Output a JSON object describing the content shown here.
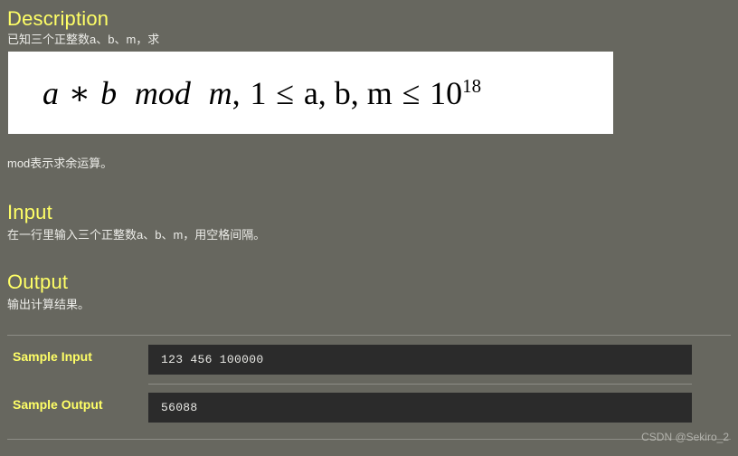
{
  "page": {
    "background_color": "#67675f",
    "heading_color": "#ffff66",
    "code_bg_color": "#2b2b2b",
    "text_color": "#ecece8"
  },
  "sections": {
    "description": {
      "heading": "Description",
      "intro_text": "已知三个正整数a、b、m，求",
      "formula": {
        "a": "a",
        "times": "∗",
        "b": "b",
        "mod": "mod",
        "m": "m",
        "comma1": ",",
        "one": "1",
        "le1": "≤",
        "vars": "a, b, m",
        "le2": "≤",
        "base": "10",
        "exponent": "18",
        "plain": "a * b mod m, 1 ≤ a, b, m ≤ 10^18"
      },
      "note_text": "mod表示求余运算。"
    },
    "input": {
      "heading": "Input",
      "text": "在一行里输入三个正整数a、b、m，用空格间隔。"
    },
    "output": {
      "heading": "Output",
      "text": "输出计算结果。"
    }
  },
  "samples": {
    "input_label": "Sample Input",
    "input_value": "123 456 100000",
    "output_label": "Sample Output",
    "output_value": "56088"
  },
  "watermark": {
    "text": "CSDN @Sekiro_2"
  }
}
